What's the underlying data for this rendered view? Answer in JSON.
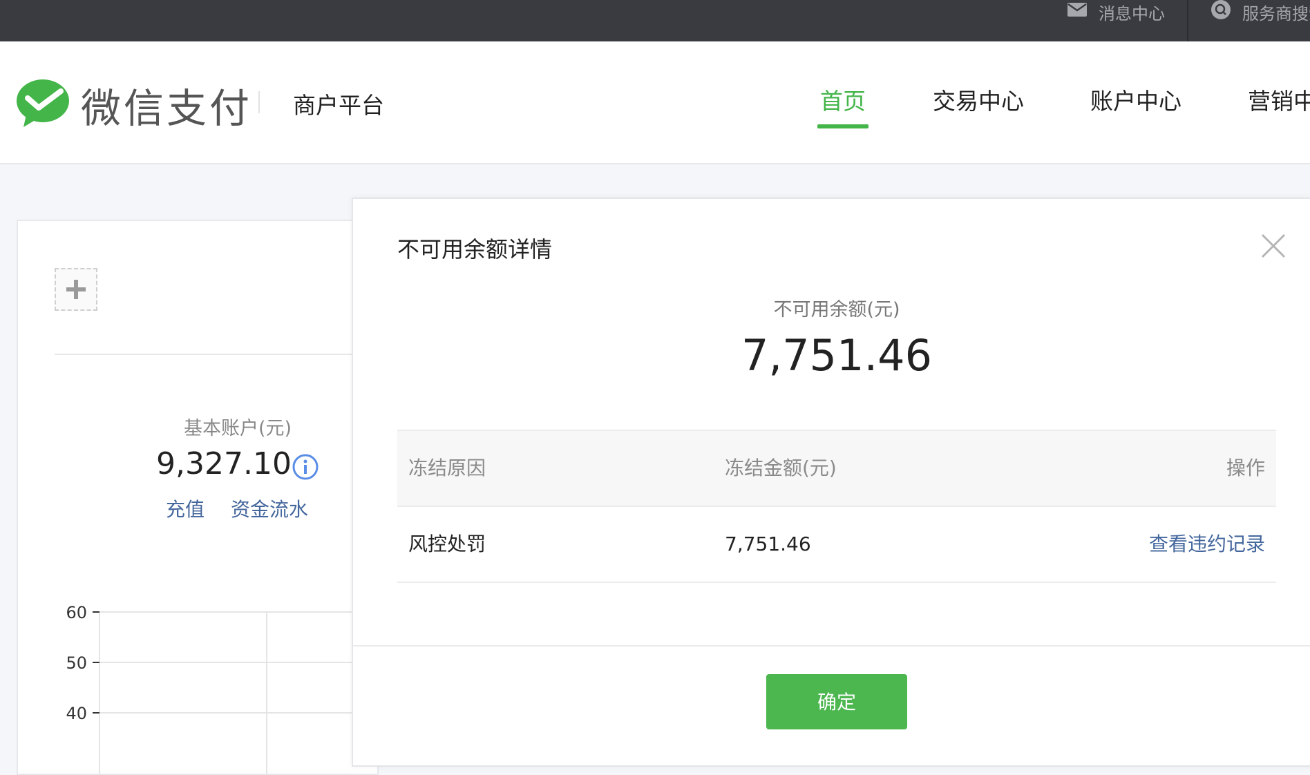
{
  "topbar": {
    "messages_label": "消息中心",
    "service_search_label": "服务商搜索"
  },
  "header": {
    "brand": "微信支付",
    "merchant_label": "商户平台",
    "nav": [
      {
        "label": "首页",
        "active": true
      },
      {
        "label": "交易中心",
        "active": false
      },
      {
        "label": "账户中心",
        "active": false
      },
      {
        "label": "营销中心",
        "active": false
      }
    ]
  },
  "account_card": {
    "label": "基本账户(元)",
    "amount": "9,327.10",
    "recharge_link": "充值",
    "flow_link": "资金流水",
    "chart": {
      "y_ticks": [
        "60",
        "50",
        "40"
      ]
    }
  },
  "modal": {
    "title": "不可用余额详情",
    "summary_label": "不可用余额(元)",
    "summary_amount": "7,751.46",
    "table": {
      "headers": [
        "冻结原因",
        "冻结金额(元)",
        "操作"
      ],
      "rows": [
        {
          "reason": "风控处罚",
          "amount": "7,751.46",
          "action": "查看违约记录"
        }
      ]
    },
    "confirm_label": "确定"
  },
  "colors": {
    "brand_green": "#44b549",
    "link_blue": "#44679d",
    "topbar_bg": "#393b40"
  },
  "icons": {
    "mail": "mail-icon",
    "search": "search-icon",
    "logo": "wechat-pay-logo-icon",
    "plus": "plus-icon",
    "info": "info-icon",
    "close": "close-icon"
  }
}
